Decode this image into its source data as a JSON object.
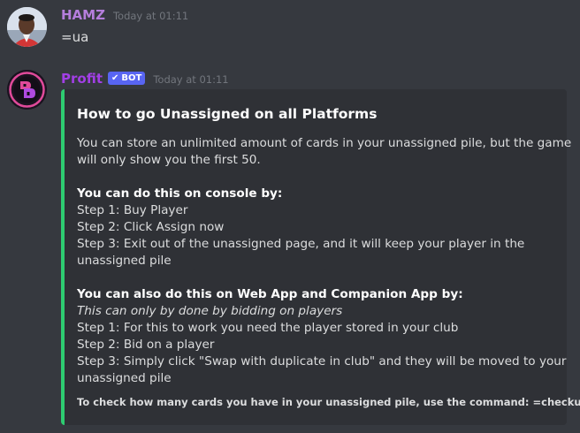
{
  "messages": [
    {
      "username": "HAMZ",
      "username_color": "#b57edc",
      "timestamp": "Today at 01:11",
      "text": "=ua"
    },
    {
      "username": "Profit",
      "username_color": "#a23fe6",
      "bot_tag": "BOT",
      "timestamp": "Today at 01:11",
      "embed": {
        "accent_color": "#2ecc71",
        "title": "How to go Unassigned on all Platforms",
        "intro_line1": "You can store an unlimited amount of cards in your unassigned pile, but the game",
        "intro_line2": "will only show you the first 50.",
        "console_heading": "You can do this on console by:",
        "console_step1": "Step 1: Buy Player",
        "console_step2": "Step 2: Click Assign now",
        "console_step3_line1": "Step 3: Exit out of the unassigned page, and it will keep your player in the",
        "console_step3_line2": "unassigned pile",
        "web_heading": "You can also do this on Web App and Companion App by:",
        "web_note": "This can only by done by bidding on players",
        "web_step1": "Step 1: For this to work you need the player stored in your club",
        "web_step2": "Step 2: Bid on a player",
        "web_step3_line1": "Step 3: Simply click \"Swap with duplicate in club\" and they will be moved to your",
        "web_step3_line2": "unassigned pile",
        "footer": "To check how many cards you have in your unassigned pile, use the command: =checkua"
      }
    }
  ]
}
